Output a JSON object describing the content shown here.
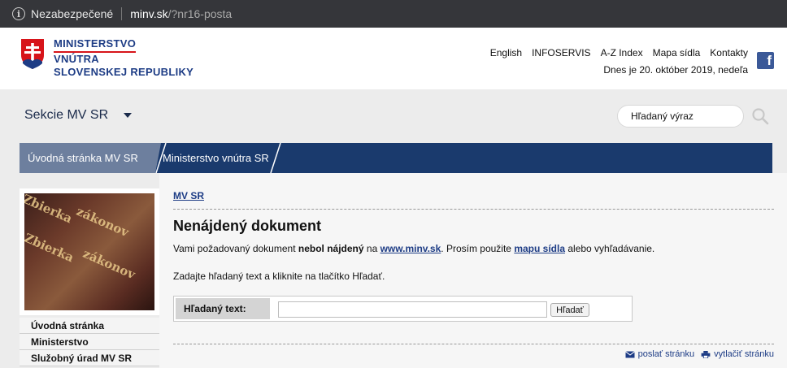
{
  "browser": {
    "security_text": "Nezabezpečené",
    "host": "minv.sk",
    "path": "/?nr16-posta"
  },
  "header": {
    "logo_lines": [
      "MINISTERSTVO",
      "VNÚTRA",
      "SLOVENSKEJ REPUBLIKY"
    ],
    "nav": [
      "English",
      "INFOSERVIS",
      "A-Z Index",
      "Mapa sídla",
      "Kontakty"
    ],
    "date": "Dnes je 20. október 2019, nedeľa",
    "facebook_icon": "f"
  },
  "sections": {
    "label": "Sekcie MV SR",
    "search_placeholder": "Hľadaný výraz"
  },
  "breadcrumb": [
    "Úvodná stránka MV SR",
    "Ministerstvo vnútra SR"
  ],
  "sidebar": {
    "image_words": [
      "Zbierka",
      "zákonov",
      "Zbierka",
      "zákonov"
    ],
    "items": [
      "Úvodná stránka",
      "Ministerstvo",
      "Služobný úrad MV SR"
    ]
  },
  "content": {
    "section_link": "MV SR",
    "title": "Nenájdený dokument",
    "msg_part1": "Vami požadovaný dokument ",
    "msg_bold": "nebol nájdený",
    "msg_part2": " na ",
    "msg_link1": "www.minv.sk",
    "msg_part3": ". Prosím použite ",
    "msg_link2": "mapu sídla",
    "msg_part4": " alebo vyhľadávanie.",
    "instruction": "Zadajte hľadaný text a kliknite na tlačítko Hľadať.",
    "search_label": "Hľadaný text:",
    "search_value": "",
    "search_button": "Hľadať",
    "send_page": "poslať stránku",
    "print_page": "vytlačiť stránku"
  },
  "colors": {
    "brand_blue": "#1d3c85",
    "band_blue": "#1a3a6d",
    "crumb_grey": "#6d7f9e",
    "flag_red": "#d7141a"
  }
}
